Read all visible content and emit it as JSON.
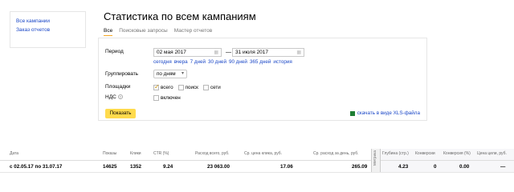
{
  "sidebar": {
    "items": [
      {
        "label": "Все кампании"
      },
      {
        "label": "Заказ отчетов"
      }
    ]
  },
  "title": "Статистика по всем кампаниям",
  "tabs": [
    {
      "label": "Все",
      "active": true
    },
    {
      "label": "Поисковые запросы",
      "active": false
    },
    {
      "label": "Мастер отчетов",
      "active": false
    }
  ],
  "form": {
    "period_label": "Период",
    "date_from": "02 мая 2017",
    "date_to": "31 июля 2017",
    "quick_periods": [
      "сегодня",
      "вчера",
      "7 дней",
      "30 дней",
      "90 дней",
      "365 дней",
      "история"
    ],
    "group_label": "Группировать",
    "group_value": "по дням",
    "platforms_label": "Площадки",
    "platforms": [
      {
        "label": "всего",
        "checked": true
      },
      {
        "label": "поиск",
        "checked": false
      },
      {
        "label": "сети",
        "checked": false
      }
    ],
    "vat_label": "НДС",
    "vat_help": "?",
    "vat_option": "включен",
    "show_button": "Показать",
    "xls_link": "скачать в виде XLS-файла"
  },
  "table": {
    "metrica_label": "Метрика",
    "headers": {
      "date": "Дата",
      "shows": "Показы",
      "clicks": "Клики",
      "ctr": "CTR (%)",
      "spend": "Расход всего, руб.",
      "cpc": "Ср. цена клика, руб.",
      "daily": "Ср. расход за день, руб.",
      "depth": "Глубина (стр.)",
      "conversions": "Конверсии",
      "conv_rate": "Конверсия (%)",
      "goal_price": "Цена цели, руб."
    },
    "row": {
      "date": "с 02.05.17 по 31.07.17",
      "shows": "14625",
      "clicks": "1352",
      "ctr": "9.24",
      "spend": "23 063.00",
      "cpc": "17.06",
      "daily": "265.09",
      "depth": "4.23",
      "conversions": "0",
      "conv_rate": "0.00",
      "goal_price": "—"
    }
  },
  "colors": {
    "link": "#1a47c7",
    "button": "#ffdb4d",
    "tab_underline": "#f5a623"
  }
}
